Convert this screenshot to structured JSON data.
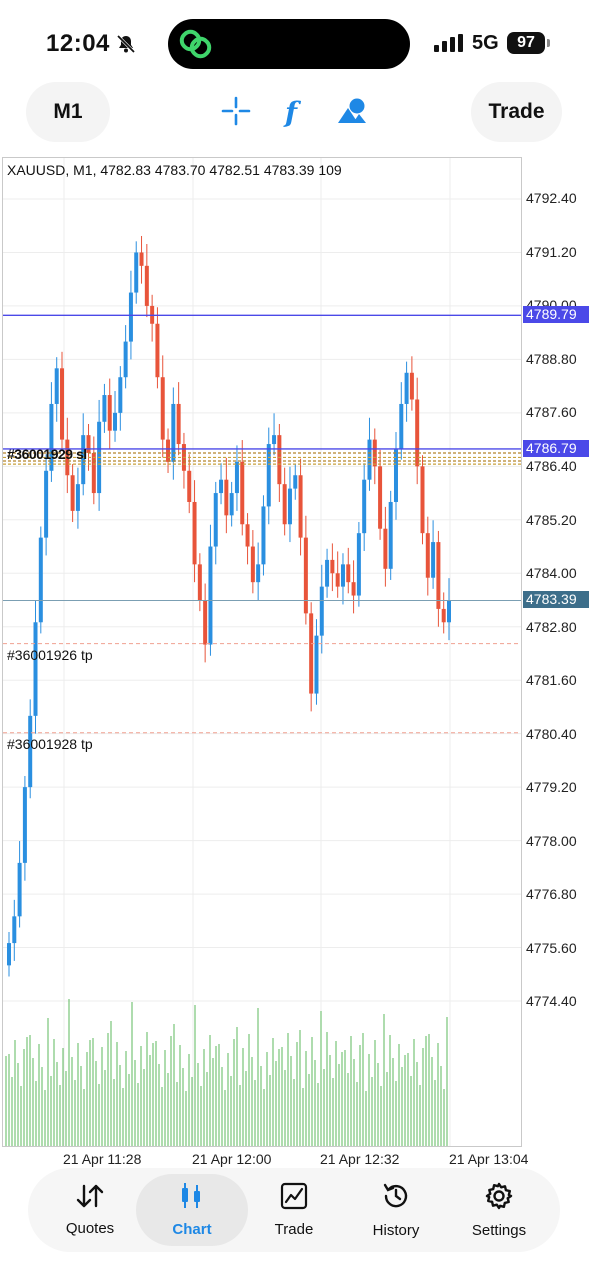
{
  "status_bar": {
    "time": "12:04",
    "network": "5G",
    "battery": "97",
    "icons": [
      "bell-slash-icon",
      "app-indicator-icon",
      "signal-bars-icon"
    ]
  },
  "toolbar": {
    "timeframe": "M1",
    "trade_label": "Trade",
    "tools": [
      "crosshair-icon",
      "function-icon",
      "objects-icon"
    ]
  },
  "chart": {
    "title": "XAUUSD, M1, 4782.83 4783.70 4782.51 4783.39 109",
    "order_labels": [
      {
        "text": "#36001926 tp"
      },
      {
        "text": "#36001928 tp"
      }
    ],
    "stacked_label": "#36001929 sl",
    "price_ticks": [
      "4792.40",
      "4791.20",
      "4790.00",
      "4788.80",
      "4787.60",
      "4786.40",
      "4785.20",
      "4784.00",
      "4782.80",
      "4781.60",
      "4780.40",
      "4779.20",
      "4778.00",
      "4776.80",
      "4775.60",
      "4774.40"
    ],
    "price_tags": [
      {
        "text": "4789.79",
        "color": "#4b49e8"
      },
      {
        "text": "4786.79",
        "color": "#4b49e8"
      },
      {
        "text": "4783.39",
        "color": "#3d6e8a"
      }
    ],
    "time_ticks": [
      "21 Apr 11:28",
      "21 Apr 12:00",
      "21 Apr 12:32",
      "21 Apr 13:04"
    ]
  },
  "colors": {
    "bull": "#2a8fe0",
    "bear": "#e8543a",
    "volume": "#5cb85c",
    "accent": "#1e88e5"
  },
  "nav": {
    "items": [
      {
        "label": "Quotes",
        "icon": "quotes-icon"
      },
      {
        "label": "Chart",
        "icon": "chart-icon",
        "active": true
      },
      {
        "label": "Trade",
        "icon": "trade-icon"
      },
      {
        "label": "History",
        "icon": "history-icon"
      },
      {
        "label": "Settings",
        "icon": "settings-icon"
      }
    ]
  }
}
